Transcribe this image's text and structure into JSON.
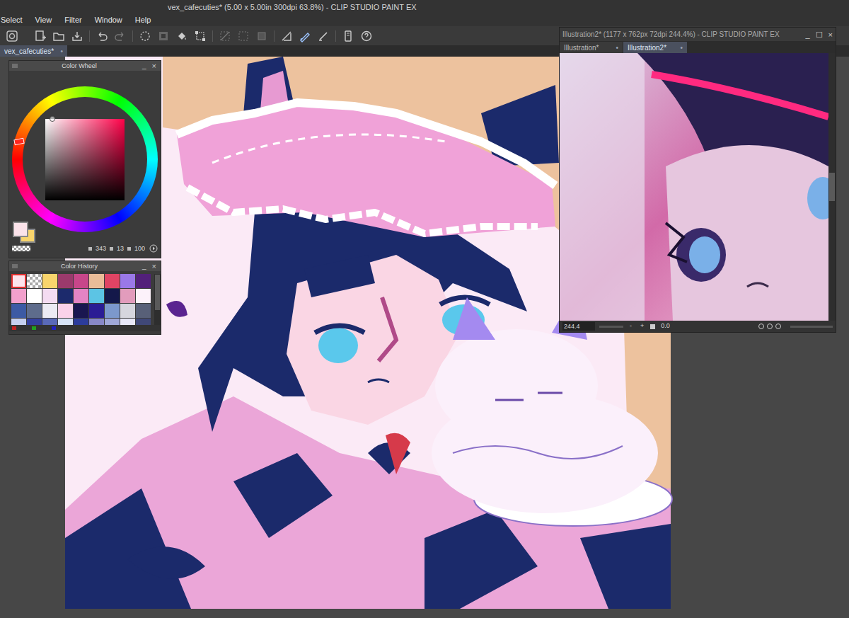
{
  "window": {
    "title": "vex_cafecuties* (5.00 x 5.00in 300dpi 63.8%) - CLIP STUDIO PAINT EX"
  },
  "menu": [
    "Select",
    "View",
    "Filter",
    "Window",
    "Help"
  ],
  "document_tabs": [
    {
      "label": "vex_cafecuties*",
      "mark": "•",
      "selected": true
    }
  ],
  "color_wheel": {
    "title": "Color Wheel",
    "minimize": "_",
    "close": "×",
    "swatches": [
      {
        "kind": "main",
        "color": "#fbe3ea"
      },
      {
        "kind": "sub",
        "color": "#f8d46c"
      }
    ],
    "values": [
      "343",
      "13",
      "100"
    ]
  },
  "color_history": {
    "title": "Color History",
    "minimize": "_",
    "close": "×",
    "swatches": [
      {
        "kind": "color",
        "color": "#fde4ec",
        "selected": true
      },
      {
        "kind": "transparent",
        "selected": false
      },
      {
        "kind": "color",
        "color": "#f8d46c",
        "selected": false
      },
      {
        "kind": "color",
        "color": "#9a3a6c",
        "selected": false
      },
      {
        "kind": "color",
        "color": "#c8468a",
        "selected": false
      },
      {
        "kind": "color",
        "color": "#eabc98",
        "selected": false
      },
      {
        "kind": "color",
        "color": "#e04464",
        "selected": false
      },
      {
        "kind": "color",
        "color": "#9a78e8",
        "selected": false
      },
      {
        "kind": "color",
        "color": "#52207a",
        "selected": false
      },
      {
        "kind": "color",
        "color": "#f2a0cc",
        "selected": false
      },
      {
        "kind": "color",
        "color": "#ffffff",
        "selected": false
      },
      {
        "kind": "color",
        "color": "#f4dcf2",
        "selected": false
      },
      {
        "kind": "color",
        "color": "#1c2a6c",
        "selected": false
      },
      {
        "kind": "color",
        "color": "#e484c4",
        "selected": false
      },
      {
        "kind": "color",
        "color": "#5cc4e4",
        "selected": false
      },
      {
        "kind": "color",
        "color": "#14184a",
        "selected": false
      },
      {
        "kind": "color",
        "color": "#e29cbc",
        "selected": false
      },
      {
        "kind": "color",
        "color": "#fcf2fa",
        "selected": false
      },
      {
        "kind": "color",
        "color": "#3c5aa4",
        "selected": false
      },
      {
        "kind": "color",
        "color": "#5e6c8c",
        "selected": false
      },
      {
        "kind": "color",
        "color": "#ecebf4",
        "selected": false
      },
      {
        "kind": "color",
        "color": "#fad2ea",
        "selected": false
      },
      {
        "kind": "color",
        "color": "#1a1650",
        "selected": false
      },
      {
        "kind": "color",
        "color": "#2a1c94",
        "selected": false
      },
      {
        "kind": "color",
        "color": "#7c98cc",
        "selected": false
      },
      {
        "kind": "color",
        "color": "#d6d6de",
        "selected": false
      },
      {
        "kind": "color",
        "color": "#586078",
        "selected": false
      },
      {
        "kind": "color",
        "color": "#c6d0f0",
        "selected": false
      },
      {
        "kind": "color",
        "color": "#3440a0",
        "selected": false
      },
      {
        "kind": "color",
        "color": "#5a6ab8",
        "selected": false
      },
      {
        "kind": "color",
        "color": "#d8e4f8",
        "selected": false
      },
      {
        "kind": "color",
        "color": "#2c3c9c",
        "selected": false
      },
      {
        "kind": "color",
        "color": "#8888c8",
        "selected": false
      },
      {
        "kind": "color",
        "color": "#a0a8d8",
        "selected": false
      },
      {
        "kind": "color",
        "color": "#e8e8f8",
        "selected": false
      },
      {
        "kind": "color",
        "color": "#404878",
        "selected": false
      }
    ]
  },
  "sub_window": {
    "title": "Illustration2* (1177 x 762px 72dpi 244.4%) - CLIP STUDIO PAINT EX",
    "controls": [
      "_",
      "☐",
      "×"
    ],
    "tabs": [
      {
        "label": "Illustration*",
        "mark": "•",
        "selected": false
      },
      {
        "label": "Illustration2*",
        "mark": "•",
        "selected": true
      }
    ],
    "zoom": "244.4",
    "zoom_out": "-",
    "zoom_in": "+",
    "rotation": "0.0"
  }
}
